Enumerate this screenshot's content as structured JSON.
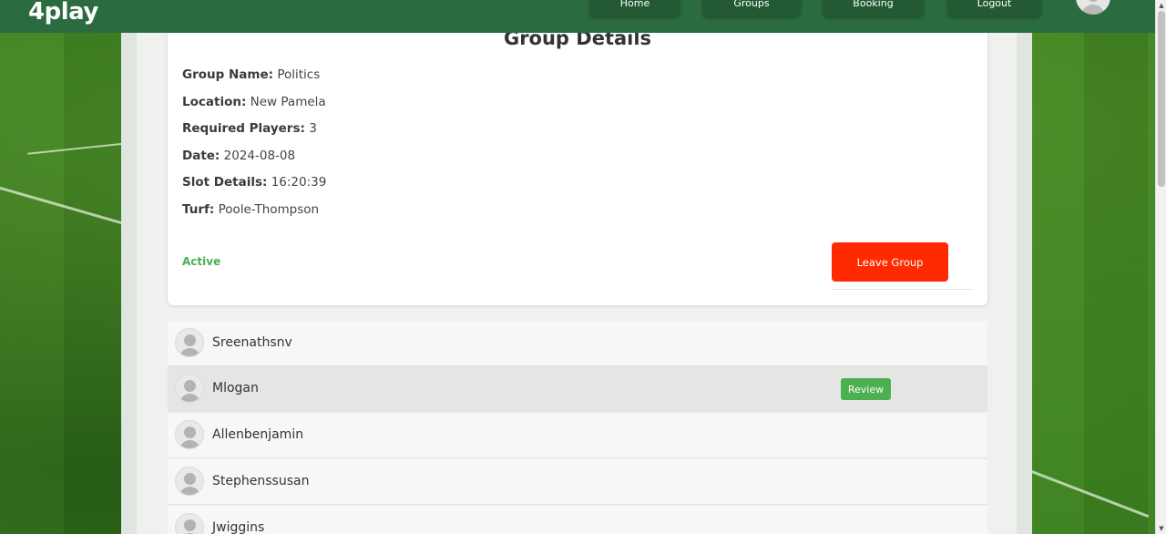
{
  "header": {
    "logo": "4play",
    "nav": [
      "Home",
      "Groups",
      "Booking",
      "Logout"
    ]
  },
  "details": {
    "title": "Group Details",
    "rows": [
      {
        "label": "Group Name:",
        "value": "Politics"
      },
      {
        "label": "Location:",
        "value": "New Pamela"
      },
      {
        "label": "Required Players:",
        "value": "3"
      },
      {
        "label": "Date:",
        "value": "2024-08-08"
      },
      {
        "label": "Slot Details:",
        "value": "16:20:39"
      },
      {
        "label": "Turf:",
        "value": "Poole-Thompson"
      }
    ],
    "status": "Active",
    "leave_label": "Leave Group"
  },
  "members": [
    {
      "name": "Sreenathsnv"
    },
    {
      "name": "Mlogan",
      "action": "Review"
    },
    {
      "name": "Allenbenjamin"
    },
    {
      "name": "Stephenssusan"
    },
    {
      "name": "Jwiggins"
    }
  ],
  "colors": {
    "brand": "#2a6b3f",
    "danger": "#ff2a00",
    "success": "#4caf50"
  },
  "icons": {
    "avatar": "user-avatar-icon",
    "scroll_up": "arrow-up-icon",
    "scroll_down": "arrow-down-icon"
  }
}
